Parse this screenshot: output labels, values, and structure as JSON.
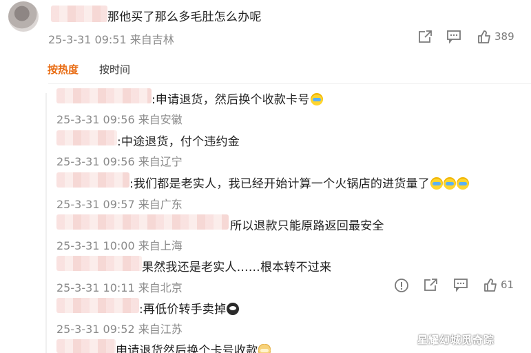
{
  "top_comment": {
    "text": "那他买了那么多毛肚怎么办呢",
    "meta": "25-3-31 09:51 来自吉林",
    "like_count": "389"
  },
  "sort_tabs": [
    {
      "label": "按热度",
      "active": true
    },
    {
      "label": "按时间",
      "active": false
    }
  ],
  "replies": [
    {
      "text": ":申请退货，然后换个收款卡号",
      "meta": "25-3-31 09:56 来自安徽"
    },
    {
      "text": ":中途退货，付个违约金",
      "meta": "25-3-31 09:56 来自辽宁"
    },
    {
      "text": ":我们都是老实人，我已经开始计算一个火锅店的进货量了",
      "meta": "25-3-31 09:57 来自广东"
    },
    {
      "text": "所以退款只能原路返回最安全",
      "meta": "25-3-31 10:00 来自上海"
    },
    {
      "text": "果然我还是老实人……根本转不过来",
      "meta": "25-3-31 10:11 来自北京",
      "like_count": "61"
    },
    {
      "text": ":再低价转手卖掉",
      "meta": "25-3-31 09:52 来自江苏"
    },
    {
      "text": "申请退货然后换个卡号收款",
      "meta": ""
    }
  ],
  "icons": {
    "share": "share-icon",
    "comment": "comment-icon",
    "like": "thumbs-up-icon",
    "report": "report-icon"
  },
  "colors": {
    "accent": "#e86c13",
    "meta_gray": "#8a8a8a"
  },
  "watermark": "星耀幻城觅奇踪"
}
